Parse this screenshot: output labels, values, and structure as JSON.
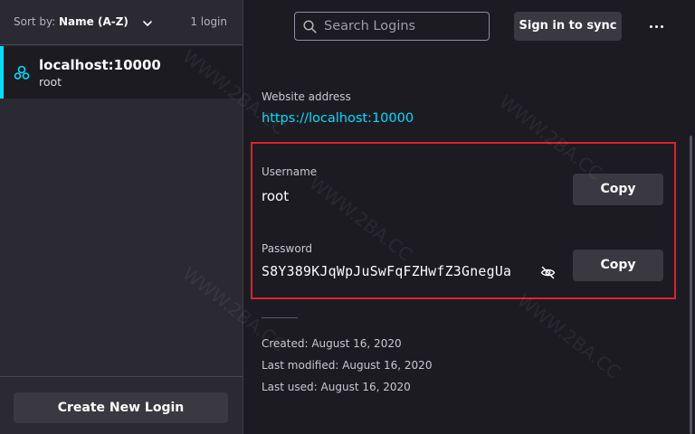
{
  "sidebar": {
    "sort_label": "Sort by:",
    "sort_value": "Name (A-Z)",
    "login_count": "1 login",
    "items": [
      {
        "title": "localhost:10000",
        "username": "root",
        "icon": "login-item-icon",
        "selected": true
      }
    ],
    "create_button": "Create New Login"
  },
  "header": {
    "search_placeholder": "Search Logins",
    "search_value": "",
    "sync_button": "Sign in to sync",
    "more_icon": "more-options-icon"
  },
  "detail": {
    "website_label": "Website address",
    "website_value": "https://localhost:10000",
    "username_label": "Username",
    "username_value": "root",
    "password_label": "Password",
    "password_value": "S8Y389KJqWpJuSwFqFZHwfZ3GnegUa",
    "copy_username_button": "Copy",
    "copy_password_button": "Copy",
    "created": "Created: August 16, 2020",
    "last_modified": "Last modified: August 16, 2020",
    "last_used": "Last used: August 16, 2020"
  },
  "watermark_text": "WWW.2BA.CC",
  "colors": {
    "accent": "#00ddff",
    "highlight": "#e0202a",
    "sidebar_bg": "#2b2a33",
    "main_bg": "#1c1b22"
  }
}
